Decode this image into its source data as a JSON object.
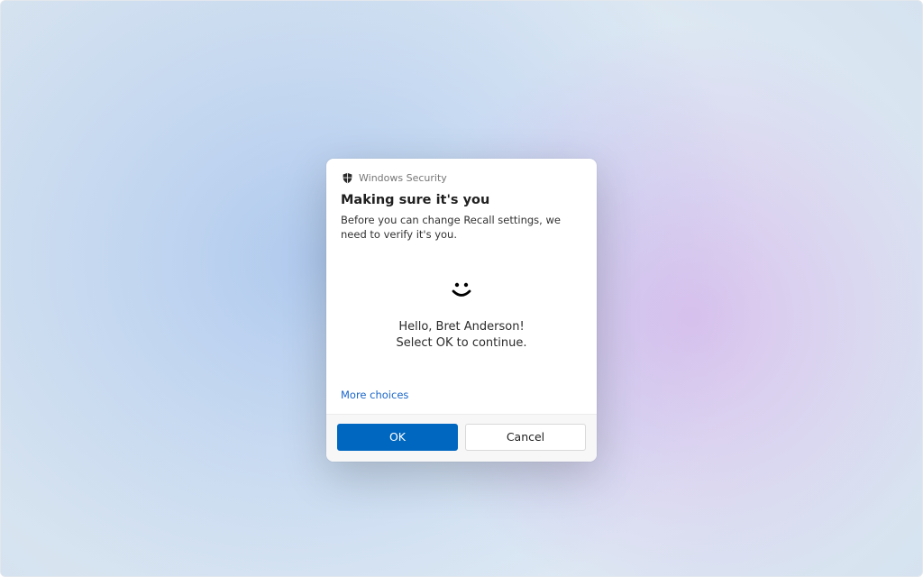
{
  "dialog": {
    "app_name": "Windows Security",
    "title": "Making sure it's you",
    "subtitle": "Before you can change Recall settings, we need to verify it's you.",
    "greeting_line1": "Hello, Bret Anderson!",
    "greeting_line2": "Select OK to continue.",
    "more_choices": "More choices",
    "ok_label": "OK",
    "cancel_label": "Cancel"
  },
  "colors": {
    "primary": "#0067c0",
    "link": "#1a66c9"
  }
}
